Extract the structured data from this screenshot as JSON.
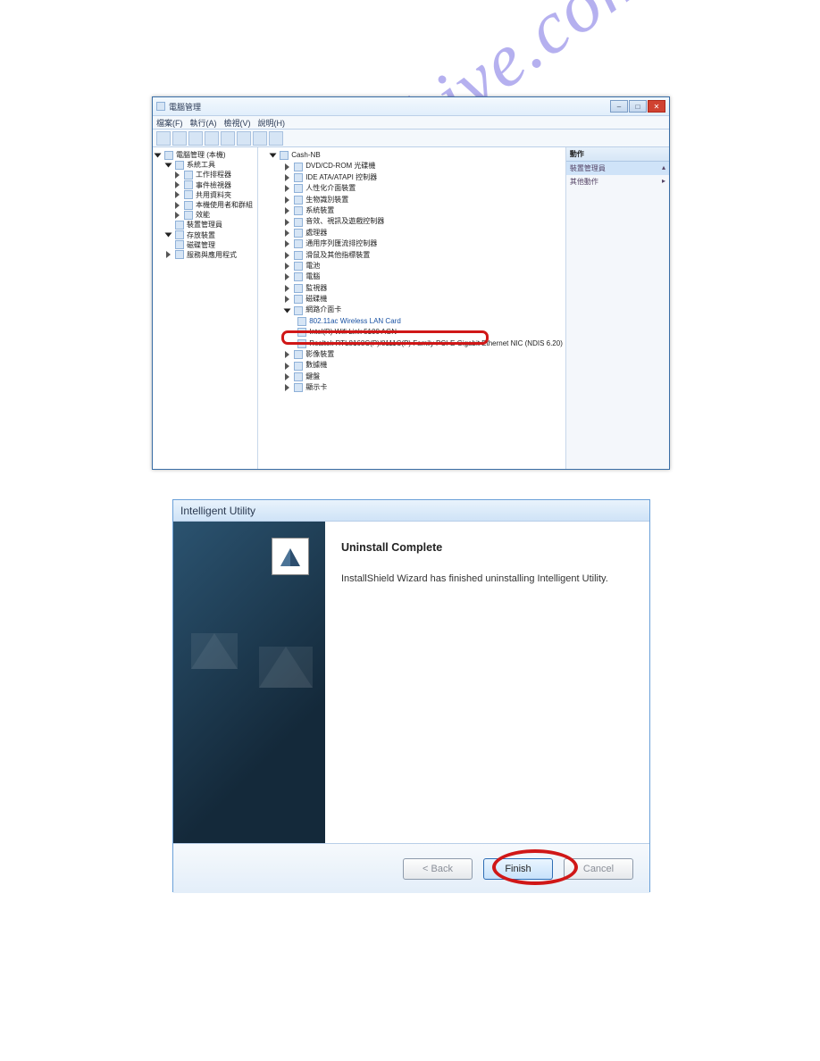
{
  "watermark": "manualshive.com",
  "dm": {
    "title": "電腦管理",
    "menus": [
      "檔案(F)",
      "執行(A)",
      "檢視(V)",
      "說明(H)"
    ],
    "left": {
      "root": "電腦管理 (本機)",
      "items": [
        "系統工具",
        "工作排程器",
        "事件檢視器",
        "共用資料夾",
        "本機使用者和群組",
        "效能",
        "裝置管理員",
        "存放裝置",
        "磁碟管理",
        "服務與應用程式"
      ]
    },
    "center": {
      "root": "Cash-NB",
      "nodes": [
        "DVD/CD-ROM 光碟機",
        "IDE ATA/ATAPI 控制器",
        "人性化介面裝置",
        "生物識別裝置",
        "系統裝置",
        "音效、視訊及遊戲控制器",
        "處理器",
        "通用序列匯流排控制器",
        "滑鼠及其他指標裝置",
        "電池",
        "電腦",
        "監視器",
        "磁碟機",
        "網路介面卡"
      ],
      "adapters": [
        "802.11ac Wireless LAN Card",
        "Intel(R) Wifi Link 5100 AGN",
        "Realtek RTL8168C(P)/8111C(P) Family PCI-E Gigabit Ethernet NIC (NDIS 6.20)"
      ],
      "nodes_after": [
        "影像裝置",
        "數據機",
        "鍵盤",
        "顯示卡"
      ]
    },
    "right": {
      "header": "動作",
      "selected": "裝置管理員",
      "other": "其他動作"
    }
  },
  "is": {
    "title": "Intelligent Utility",
    "heading": "Uninstall Complete",
    "body": "InstallShield Wizard has finished uninstalling Intelligent Utility.",
    "buttons": {
      "back": "< Back",
      "finish": "Finish",
      "cancel": "Cancel"
    }
  }
}
